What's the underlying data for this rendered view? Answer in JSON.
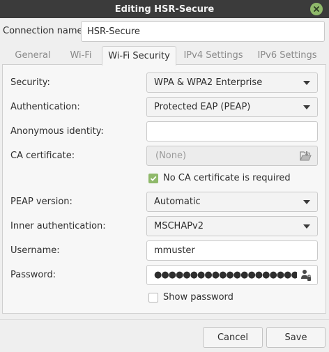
{
  "window": {
    "title": "Editing HSR-Secure",
    "close_icon": "close-icon",
    "accent_color": "#8fb96a"
  },
  "connection": {
    "label": "Connection name:",
    "value": "HSR-Secure"
  },
  "tabs": [
    {
      "label": "General",
      "active": false
    },
    {
      "label": "Wi-Fi",
      "active": false
    },
    {
      "label": "Wi-Fi Security",
      "active": true
    },
    {
      "label": "IPv4 Settings",
      "active": false
    },
    {
      "label": "IPv6 Settings",
      "active": false
    }
  ],
  "form": {
    "security": {
      "label": "Security:",
      "value": "WPA & WPA2 Enterprise"
    },
    "authentication": {
      "label": "Authentication:",
      "value": "Protected EAP (PEAP)"
    },
    "anonymous_identity": {
      "label": "Anonymous identity:",
      "value": ""
    },
    "ca_certificate": {
      "label": "CA certificate:",
      "value": "(None)",
      "icon": "file-open-icon"
    },
    "no_ca_required": {
      "label": "No CA certificate is required",
      "checked": true
    },
    "peap_version": {
      "label": "PEAP version:",
      "value": "Automatic"
    },
    "inner_authentication": {
      "label": "Inner authentication:",
      "value": "MSCHAPv2"
    },
    "username": {
      "label": "Username:",
      "value": "mmuster"
    },
    "password": {
      "label": "Password:",
      "value": "●●●●●●●●●●●●●●●●●●●●●●●●●●●●●●●",
      "icon": "user-key-icon"
    },
    "show_password": {
      "label": "Show password",
      "checked": false
    }
  },
  "buttons": {
    "cancel": "Cancel",
    "save": "Save"
  }
}
